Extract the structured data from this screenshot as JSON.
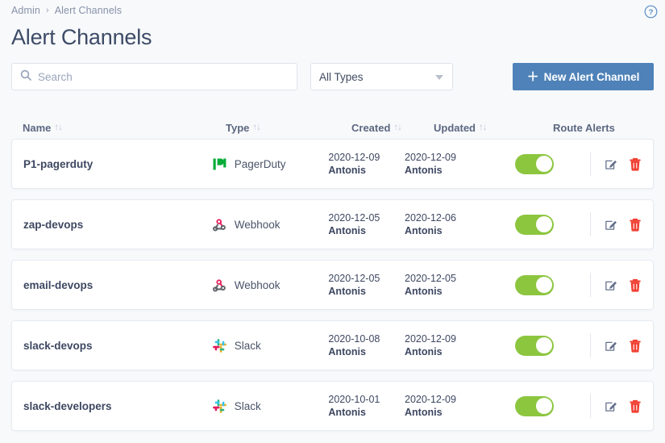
{
  "breadcrumb": {
    "parent": "Admin",
    "separator": "›",
    "current": "Alert Channels"
  },
  "header": {
    "title": "Alert Channels",
    "help_icon": "help-circle-icon"
  },
  "toolbar": {
    "search": {
      "placeholder": "Search",
      "value": "",
      "icon": "search-icon"
    },
    "type_filter": {
      "selected": "All Types",
      "icon": "chevron-down-icon"
    },
    "new_button": {
      "label": "New Alert Channel",
      "plus": "＋",
      "color": "#4e82b8"
    }
  },
  "table": {
    "sort_glyph": "↑↓",
    "columns": [
      {
        "key": "name",
        "label": "Name",
        "sortable": true
      },
      {
        "key": "type",
        "label": "Type",
        "sortable": true
      },
      {
        "key": "created",
        "label": "Created",
        "sortable": true
      },
      {
        "key": "updated",
        "label": "Updated",
        "sortable": true
      },
      {
        "key": "route",
        "label": "Route Alerts",
        "sortable": false
      }
    ],
    "rows": [
      {
        "name": "P1-pagerduty",
        "type": "PagerDuty",
        "type_icon": "pagerduty-icon",
        "created_date": "2020-12-09",
        "created_user": "Antonis",
        "updated_date": "2020-12-09",
        "updated_user": "Antonis",
        "route_alerts": true
      },
      {
        "name": "zap-devops",
        "type": "Webhook",
        "type_icon": "webhook-icon",
        "created_date": "2020-12-05",
        "created_user": "Antonis",
        "updated_date": "2020-12-06",
        "updated_user": "Antonis",
        "route_alerts": true
      },
      {
        "name": "email-devops",
        "type": "Webhook",
        "type_icon": "webhook-icon",
        "created_date": "2020-12-05",
        "created_user": "Antonis",
        "updated_date": "2020-12-05",
        "updated_user": "Antonis",
        "route_alerts": true
      },
      {
        "name": "slack-devops",
        "type": "Slack",
        "type_icon": "slack-icon",
        "created_date": "2020-10-08",
        "created_user": "Antonis",
        "updated_date": "2020-12-09",
        "updated_user": "Antonis",
        "route_alerts": true
      },
      {
        "name": "slack-developers",
        "type": "Slack",
        "type_icon": "slack-icon",
        "created_date": "2020-10-01",
        "created_user": "Antonis",
        "updated_date": "2020-12-09",
        "updated_user": "Antonis",
        "route_alerts": true
      }
    ],
    "actions": {
      "edit_icon": "edit-pencil-icon",
      "delete_icon": "trash-delete-icon"
    }
  },
  "colors": {
    "page_background": "#f7f9fb",
    "accent_blue": "#4e82b8",
    "toggle_on_green": "#8cc63f",
    "delete_red": "#f04134",
    "pagerduty_green": "#06ac38",
    "webhook_gray": "#5f6368",
    "webhook_pink": "#e8255f",
    "slack_blue": "#36c5f0",
    "slack_green": "#2eb67d",
    "slack_red": "#e01e5a",
    "slack_yellow": "#ecb22e"
  }
}
